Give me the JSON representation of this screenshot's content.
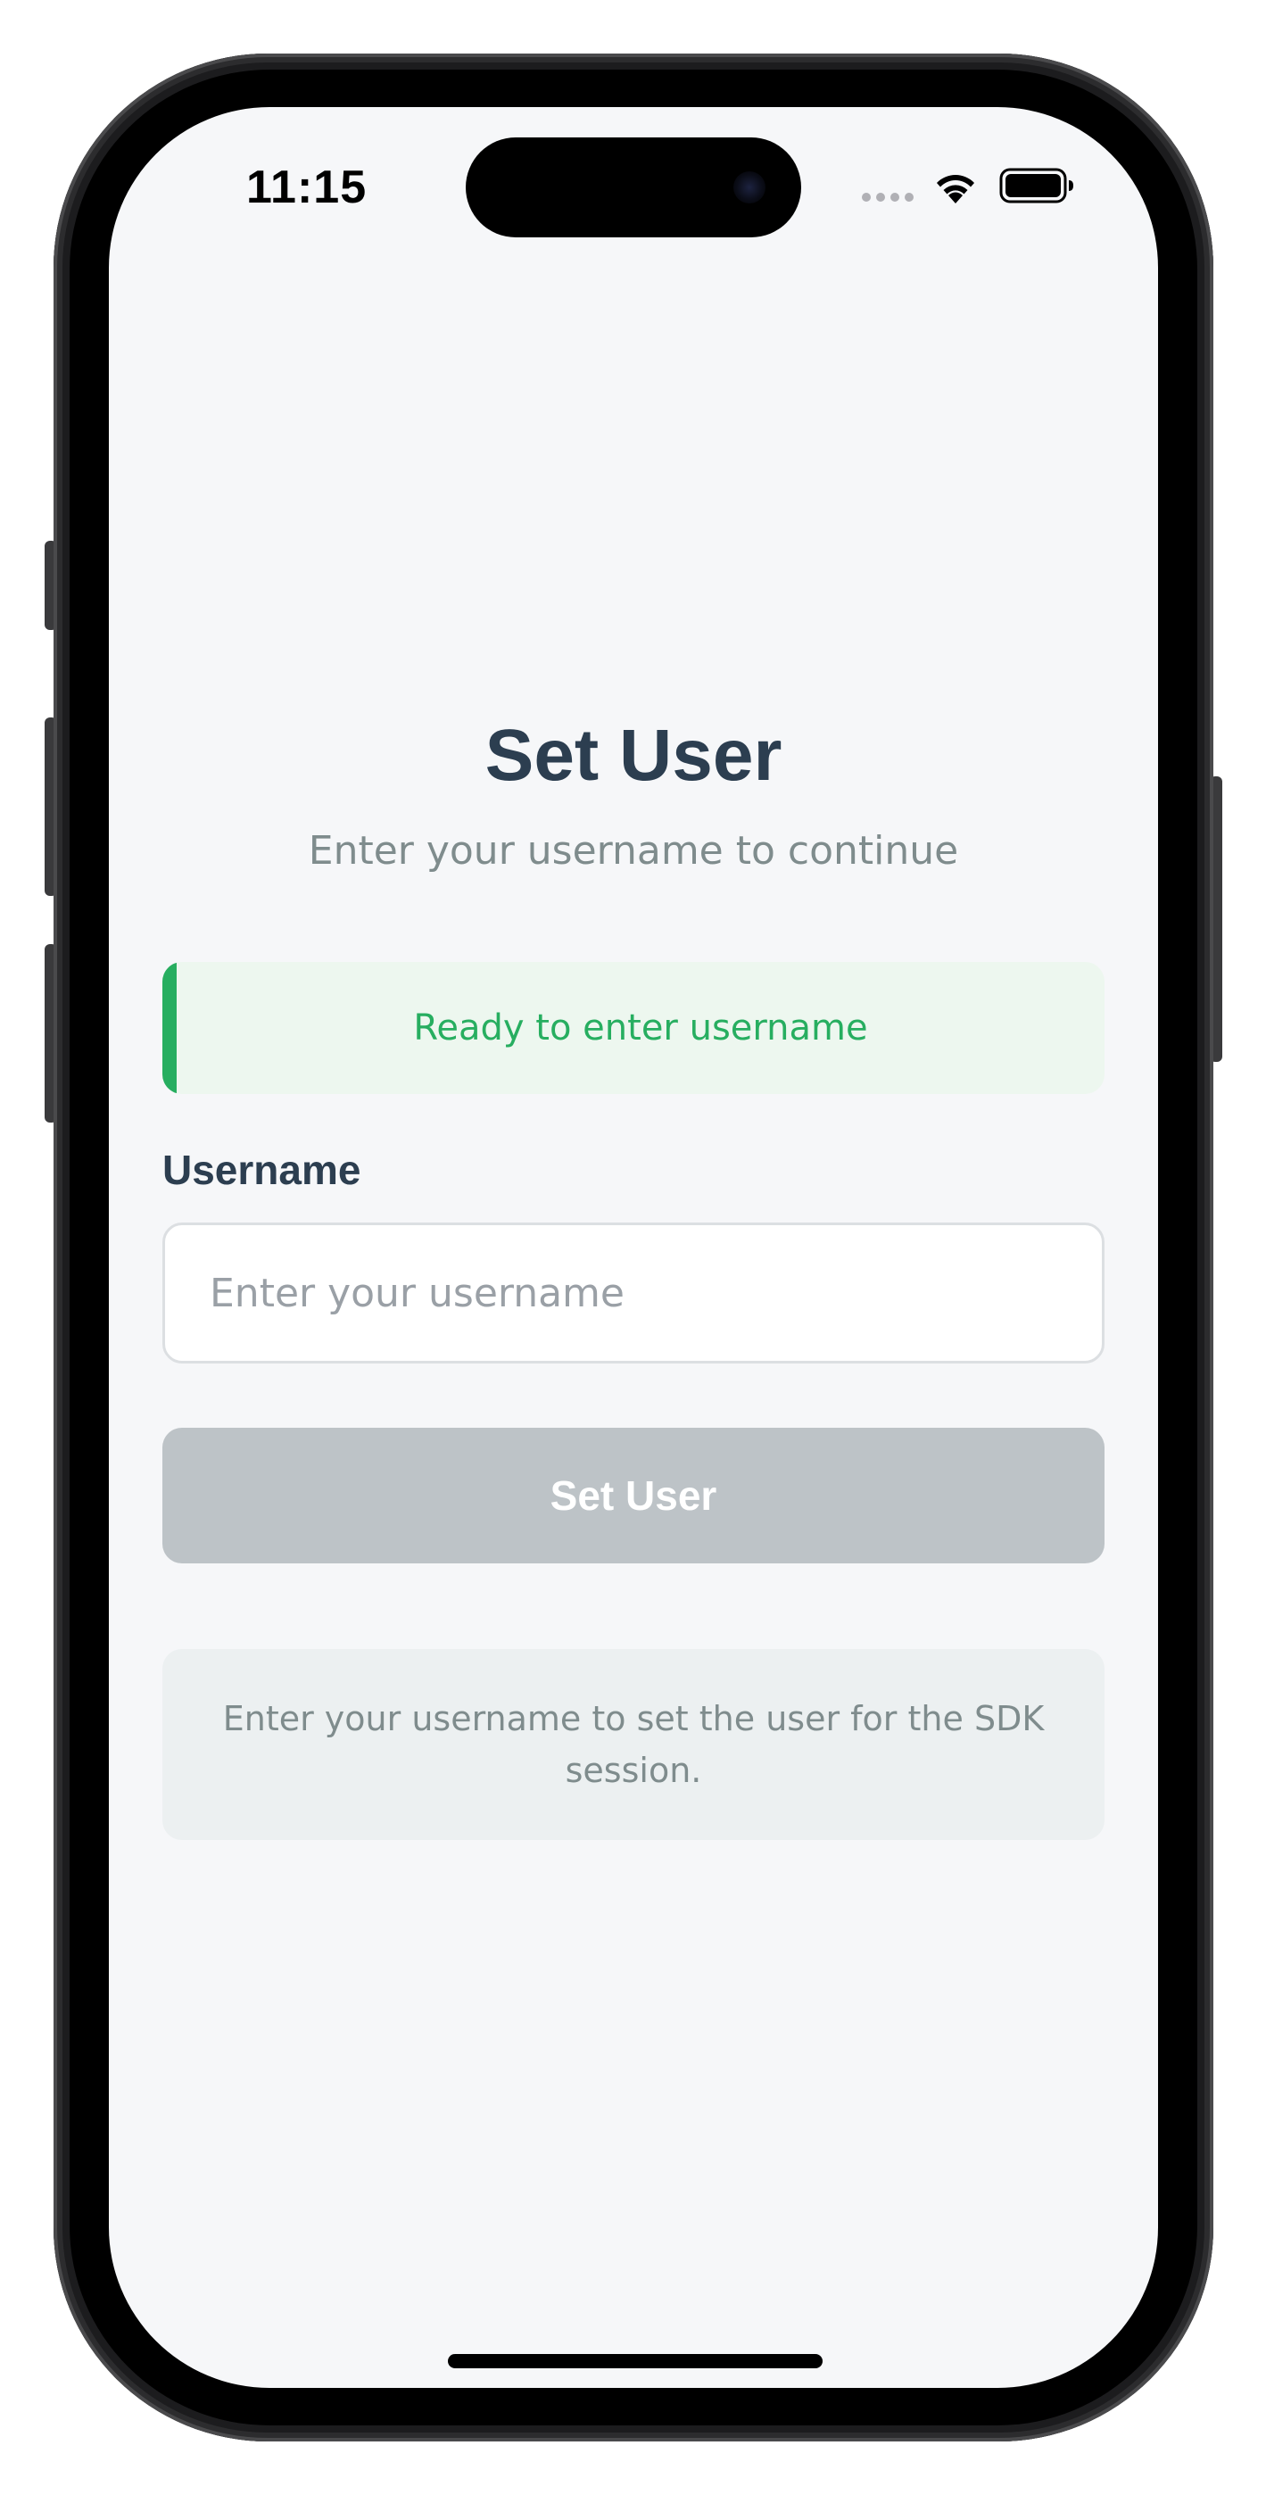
{
  "status_bar": {
    "time": "11:15",
    "icons": [
      "cellular-signal-icon",
      "wifi-icon",
      "battery-icon"
    ]
  },
  "page": {
    "title": "Set User",
    "subtitle": "Enter your username to continue"
  },
  "status_message": {
    "text": "Ready to enter username",
    "color": "#27ae60",
    "background": "#edf7ef"
  },
  "form": {
    "username_label": "Username",
    "username_value": "",
    "username_placeholder": "Enter your username",
    "submit_label": "Set User",
    "submit_disabled_color": "#bdc3c7"
  },
  "info": {
    "text": "Enter your username to set the user for the SDK session."
  },
  "colors": {
    "heading": "#2c3e50",
    "muted": "#7f8c8d",
    "screen_background": "#f6f7f9"
  }
}
